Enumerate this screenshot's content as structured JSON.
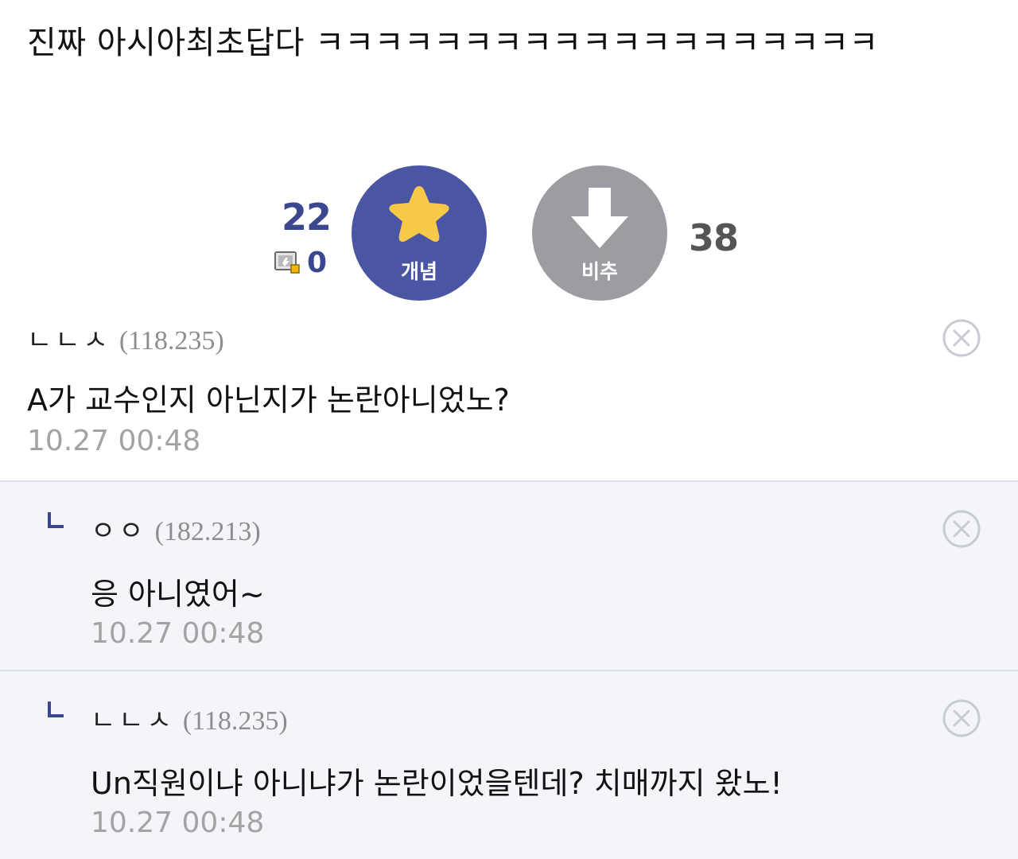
{
  "post": {
    "body_text": "진짜 아시아최초답다 ㅋㅋㅋㅋㅋㅋㅋㅋㅋㅋㅋㅋㅋㅋㅋㅋㅋㅋㅋ"
  },
  "vote": {
    "recommend_count": "22",
    "fixed_count": "0",
    "upvote_label": "개념",
    "downvote_label": "비추",
    "downvote_count": "38",
    "colors": {
      "upvote_bg": "#4a55a3",
      "upvote_star": "#f7c948",
      "downvote_bg": "#9c9da3",
      "count_blue": "#3b4890"
    },
    "icons": {
      "upvote": "star-icon",
      "downvote": "arrow-down-icon",
      "fixed": "fixed-recommend-icon"
    }
  },
  "comments": [
    {
      "nickname": "ㄴㄴㅅ",
      "ip": "(118.235)",
      "text": "A가 교수인지 아닌지가 논란아니었노?",
      "time": "10.27 00:48",
      "is_reply": false
    },
    {
      "nickname": "ㅇㅇ",
      "ip": "(182.213)",
      "text": "응 아니였어~",
      "time": "10.27 00:48",
      "is_reply": true
    },
    {
      "nickname": "ㄴㄴㅅ",
      "ip": "(118.235)",
      "text": "Un직원이냐 아니냐가 논란이었을텐데? 치매까지 왔노!",
      "time": "10.27 00:48",
      "is_reply": true
    }
  ],
  "ui": {
    "reply_bg": "#f3f5f9",
    "divider": "#dde0ea",
    "delete_icon": "close-circle-icon",
    "reply_icon": "reply-arrow-icon"
  }
}
